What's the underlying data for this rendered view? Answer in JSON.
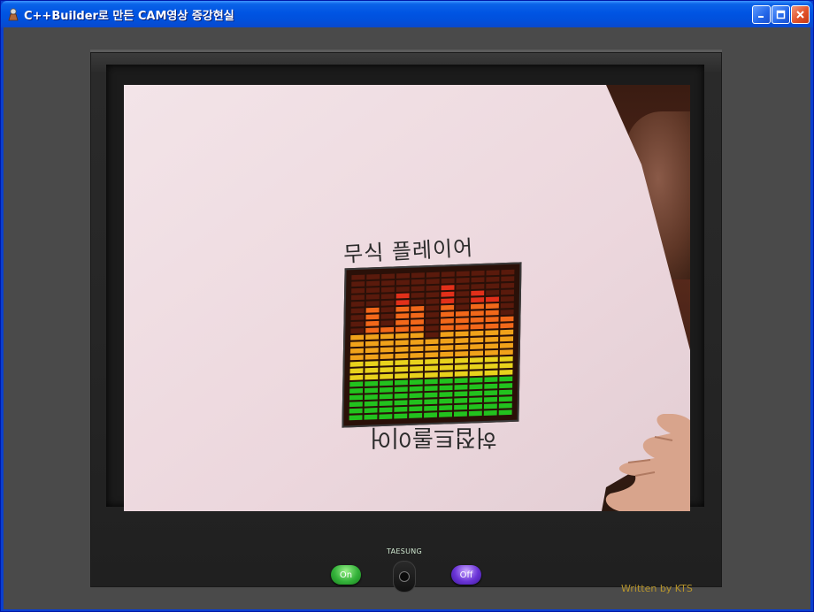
{
  "window": {
    "title": "C++Builder로 만든 CAM영상 증강현실"
  },
  "screen": {
    "player_title": "무식 플레이어",
    "mirrored_caption": "허접트롤이어"
  },
  "equalizer": {
    "columns": 11,
    "levels": [
      0.58,
      0.76,
      0.64,
      0.85,
      0.78,
      0.55,
      0.9,
      0.72,
      0.88,
      0.8,
      0.7
    ]
  },
  "controls": {
    "brand": "TAESUNG",
    "on_label": "On",
    "off_label": "Off"
  },
  "credit": "Written by KTS",
  "colors": {
    "title_bar": "#0054e3",
    "bezel": "#262626",
    "paper": "#efdde2",
    "credit": "#b6942c"
  }
}
